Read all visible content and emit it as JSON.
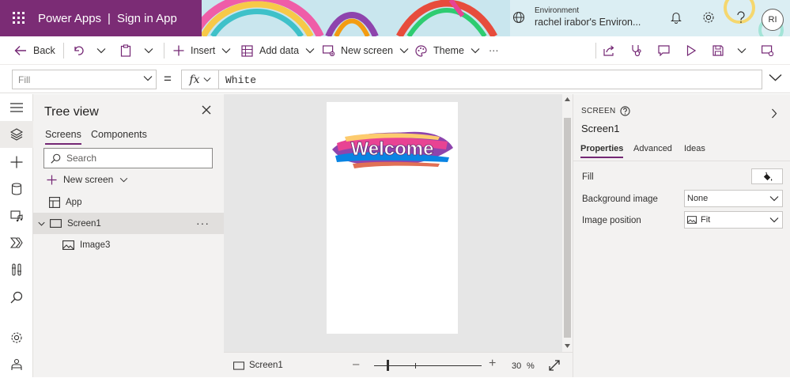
{
  "header": {
    "app_name": "Power Apps",
    "app_title": "Sign in App",
    "environment_label": "Environment",
    "environment_name": "rachel irabor's Environ...",
    "avatar_initials": "RI"
  },
  "command_bar": {
    "back": "Back",
    "insert": "Insert",
    "add_data": "Add data",
    "new_screen": "New screen",
    "theme": "Theme",
    "more": "···"
  },
  "formula_bar": {
    "property": "Fill",
    "equals": "=",
    "fx": "fx",
    "formula": "White"
  },
  "tree_view": {
    "title": "Tree view",
    "tabs": [
      "Screens",
      "Components"
    ],
    "search_placeholder": "Search",
    "new_screen": "New screen",
    "items": [
      {
        "label": "App"
      },
      {
        "label": "Screen1",
        "more": "···"
      },
      {
        "label": "Image3"
      }
    ]
  },
  "canvas": {
    "welcome_text": "Welcome",
    "footer_screen": "Screen1",
    "zoom_value": "30",
    "zoom_unit": "%",
    "zoom_level": 0.3
  },
  "properties": {
    "kind": "SCREEN",
    "name": "Screen1",
    "tabs": [
      "Properties",
      "Advanced",
      "Ideas"
    ],
    "fill_label": "Fill",
    "background_image_label": "Background image",
    "background_image_value": "None",
    "image_position_label": "Image position",
    "image_position_value": "Fit"
  },
  "colors": {
    "brand": "#742774",
    "header": "#7b2c75",
    "canvas_bg": "#e6e6e6",
    "panel_bg": "#f3f2f1"
  }
}
